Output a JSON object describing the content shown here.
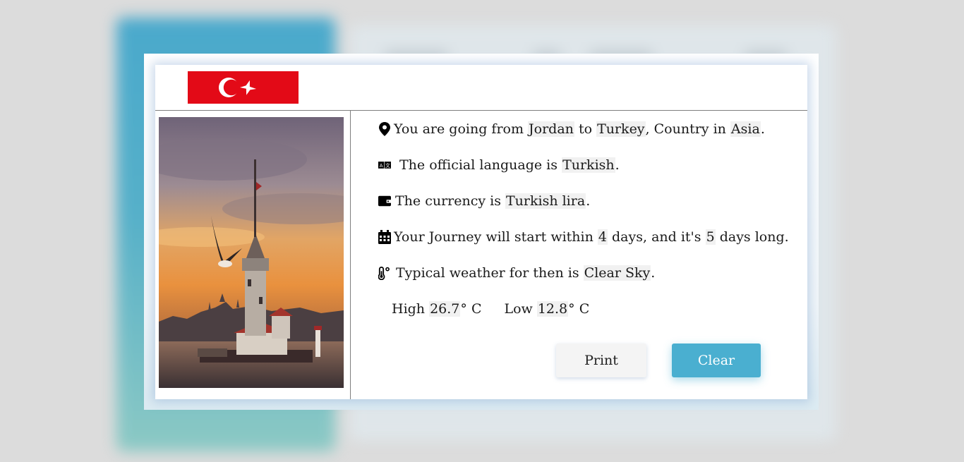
{
  "trip": {
    "from_prefix": "You are going from ",
    "origin": "Jordan",
    "to_word": " to ",
    "destination": "Turkey",
    "country_in": ", Country in ",
    "continent": "Asia",
    "end_dot": "."
  },
  "language": {
    "prefix": "The official language is ",
    "value": "Turkish",
    "suffix": "."
  },
  "currency": {
    "prefix": "The currency is ",
    "value": "Turkish lira",
    "suffix": "."
  },
  "journey": {
    "prefix": "Your Journey will start within ",
    "start_days": "4",
    "mid": " days, and it's ",
    "length_days": "5",
    "suffix": " days long."
  },
  "weather": {
    "prefix": "Typical weather for then is ",
    "value": "Clear Sky",
    "suffix": ".",
    "high_label": "High ",
    "high_value": "26.7",
    "high_unit": "° C",
    "low_label": "Low ",
    "low_value": "12.8",
    "low_unit": "° C"
  },
  "buttons": {
    "print": "Print",
    "clear": "Clear"
  },
  "icons": {
    "trip": "map-marker-icon",
    "language": "language-icon",
    "currency": "wallet-icon",
    "journey": "calendar-icon",
    "weather": "thermometer-icon"
  },
  "colors": {
    "flag_red": "#e30a17",
    "clear_button": "#4aafd0",
    "highlight": "#f1f1f1"
  }
}
